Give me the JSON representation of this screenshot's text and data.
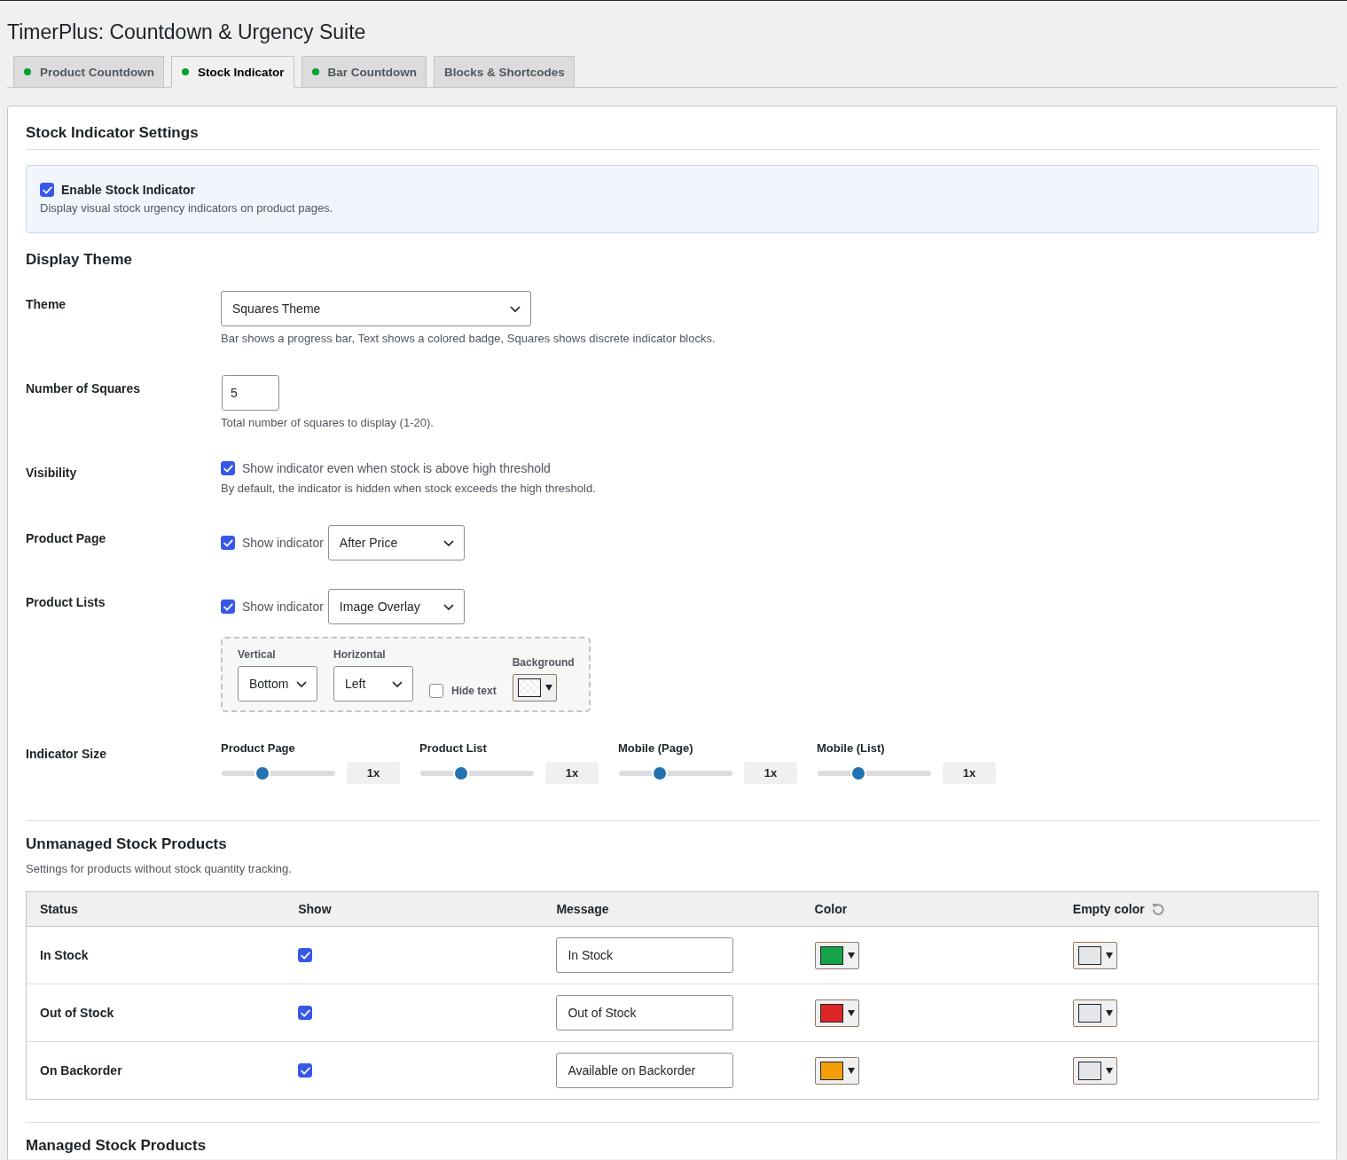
{
  "page": {
    "title": "TimerPlus: Countdown & Urgency Suite"
  },
  "tabs": [
    {
      "label": "Product Countdown",
      "selected": false,
      "dot": true
    },
    {
      "label": "Stock Indicator",
      "selected": true,
      "dot": true
    },
    {
      "label": "Bar Countdown",
      "selected": false,
      "dot": true
    },
    {
      "label": "Blocks & Shortcodes",
      "selected": false,
      "dot": false
    }
  ],
  "settings": {
    "title": "Stock Indicator Settings",
    "enable": {
      "label": "Enable Stock Indicator",
      "checked": true,
      "description": "Display visual stock urgency indicators on product pages."
    }
  },
  "display_theme": {
    "title": "Display Theme",
    "rows": [
      {
        "kind": "select",
        "label": "Theme",
        "value": "Squares Theme",
        "description": "Bar shows a progress bar, Text shows a colored badge, Squares shows discrete indicator blocks."
      },
      {
        "kind": "number",
        "label": "Number of Squares",
        "value": "5",
        "description": "Total number of squares to display (1-20)."
      },
      {
        "kind": "checkbox",
        "label": "Visibility",
        "checkbox_label": "Show indicator even when stock is above high threshold",
        "checked": true,
        "description": "By default, the indicator is hidden when stock exceeds the high threshold."
      },
      {
        "kind": "checkbox_select",
        "label": "Product Page",
        "checkbox_label": "Show indicator",
        "checked": true,
        "value": "After Price"
      },
      {
        "kind": "checkbox_select",
        "label": "Product Lists",
        "checkbox_label": "Show indicator",
        "checked": true,
        "value": "Image Overlay",
        "overlay": {
          "vertical": {
            "label": "Vertical",
            "value": "Bottom"
          },
          "horizontal": {
            "label": "Horizontal",
            "value": "Left"
          },
          "hide_text": {
            "label": "Hide text",
            "checked": false
          },
          "background": {
            "label": "Background"
          }
        }
      },
      {
        "kind": "sliders",
        "label": "Indicator Size",
        "sliders": [
          {
            "label": "Product Page",
            "level": 0.36,
            "reading": "1x"
          },
          {
            "label": "Product List",
            "level": 0.36,
            "reading": "1x"
          },
          {
            "label": "Mobile (Page)",
            "level": 0.36,
            "reading": "1x"
          },
          {
            "label": "Mobile (List)",
            "level": 0.36,
            "reading": "1x"
          }
        ]
      }
    ]
  },
  "unmanaged": {
    "title": "Unmanaged Stock Products",
    "description": "Settings for products without stock quantity tracking.",
    "table": {
      "columns": [
        {
          "label": "Status",
          "reset": false
        },
        {
          "label": "Show",
          "reset": false
        },
        {
          "label": "Message",
          "reset": false
        },
        {
          "label": "Color",
          "reset": false
        },
        {
          "label": "Empty color",
          "reset": true
        }
      ],
      "rows": [
        {
          "status": "In Stock",
          "show": true,
          "message": "In Stock",
          "color": "#16a34a",
          "empty": {
            "color": "#e5e7eb"
          }
        },
        {
          "status": "Out of Stock",
          "show": true,
          "message": "Out of Stock",
          "color": "#dc2626",
          "empty": {
            "color": "#e5e7eb"
          }
        },
        {
          "status": "On Backorder",
          "show": true,
          "message": "Available on Backorder",
          "color": "#f59e0b",
          "empty": {
            "color": "#e5e7eb"
          }
        }
      ]
    }
  },
  "managed": {
    "title": "Managed Stock Products"
  }
}
